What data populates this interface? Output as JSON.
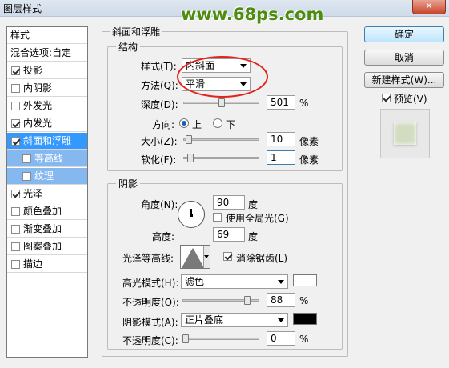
{
  "window": {
    "title": "图层样式",
    "close_glyph": "✕"
  },
  "watermark": "www.68ps.com",
  "style_list": [
    {
      "label": "样式",
      "kind": "head"
    },
    {
      "label": "混合选项:自定",
      "kind": "nobox"
    },
    {
      "label": "投影",
      "checked": true
    },
    {
      "label": "内阴影",
      "checked": false
    },
    {
      "label": "外发光",
      "checked": false
    },
    {
      "label": "内发光",
      "checked": true
    },
    {
      "label": "斜面和浮雕",
      "checked": true,
      "selected": true
    },
    {
      "label": "等高线",
      "checked": false,
      "sub": true
    },
    {
      "label": "纹理",
      "checked": false,
      "sub": true
    },
    {
      "label": "光泽",
      "checked": true
    },
    {
      "label": "颜色叠加",
      "checked": false
    },
    {
      "label": "渐变叠加",
      "checked": false
    },
    {
      "label": "图案叠加",
      "checked": false
    },
    {
      "label": "描边",
      "checked": false
    }
  ],
  "bevel": {
    "section_title": "斜面和浮雕",
    "structure_title": "结构",
    "style_label": "样式(T):",
    "style_value": "内斜面",
    "technique_label": "方法(Q):",
    "technique_value": "平滑",
    "depth_label": "深度(D):",
    "depth_value": "501",
    "depth_unit": "%",
    "direction_label": "方向:",
    "direction_up": "上",
    "direction_down": "下",
    "direction_selected": "up",
    "size_label": "大小(Z):",
    "size_value": "10",
    "size_unit": "像素",
    "soften_label": "软化(F):",
    "soften_value": "1",
    "soften_unit": "像素",
    "shading_title": "阴影",
    "angle_label": "角度(N):",
    "angle_value": "90",
    "angle_unit": "度",
    "global_light_label": "使用全局光(G)",
    "global_light_checked": false,
    "altitude_label": "高度:",
    "altitude_value": "69",
    "altitude_unit": "度",
    "gloss_contour_label": "光泽等高线:",
    "antialias_label": "消除锯齿(L)",
    "antialias_checked": true,
    "highlight_mode_label": "高光模式(H):",
    "highlight_mode_value": "滤色",
    "highlight_color": "#ffffff",
    "highlight_opacity_label": "不透明度(O):",
    "highlight_opacity_value": "88",
    "highlight_opacity_unit": "%",
    "shadow_mode_label": "阴影模式(A):",
    "shadow_mode_value": "正片叠底",
    "shadow_color": "#000000",
    "shadow_opacity_label": "不透明度(C):",
    "shadow_opacity_value": "0",
    "shadow_opacity_unit": "%",
    "depth_fraction": 0.5,
    "size_fraction": 0.04,
    "soften_fraction": 0.06,
    "highlight_opacity_fraction": 0.88,
    "shadow_opacity_fraction": 0.0
  },
  "buttons": {
    "ok": "确定",
    "cancel": "取消",
    "new_style": "新建样式(W)...",
    "preview_label": "预览(V)",
    "preview_checked": true
  },
  "colors": {
    "accent": "#3399ff",
    "annotation": "#e2231a",
    "watermark": "#4e8c10"
  }
}
